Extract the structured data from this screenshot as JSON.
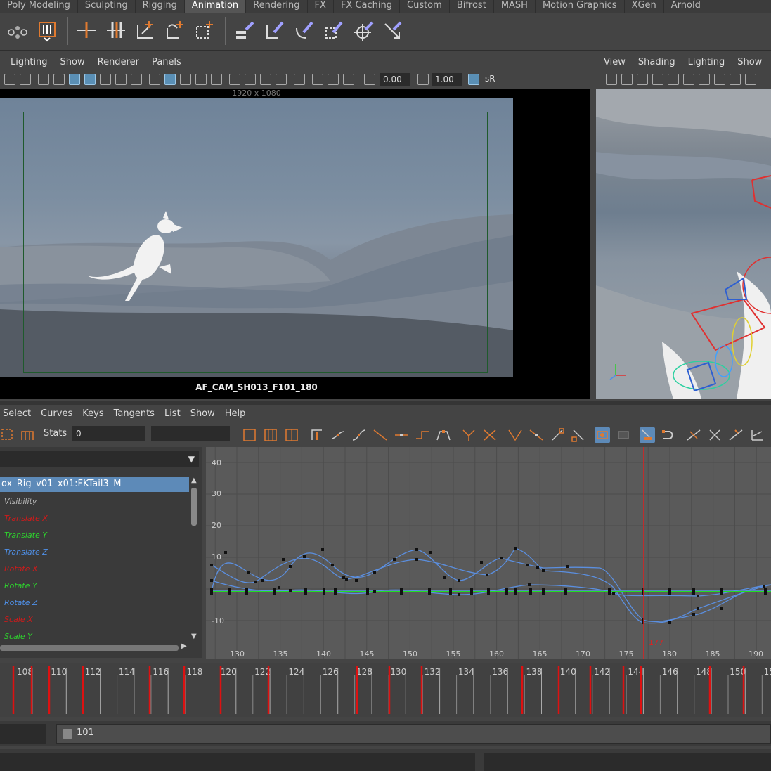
{
  "shelf": {
    "tabs": [
      {
        "label": "Poly Modeling",
        "active": false
      },
      {
        "label": "Sculpting",
        "active": false
      },
      {
        "label": "Rigging",
        "active": false
      },
      {
        "label": "Animation",
        "active": true
      },
      {
        "label": "Rendering",
        "active": false
      },
      {
        "label": "FX",
        "active": false
      },
      {
        "label": "FX Caching",
        "active": false
      },
      {
        "label": "Custom",
        "active": false
      },
      {
        "label": "Bifrost",
        "active": false
      },
      {
        "label": "MASH",
        "active": false
      },
      {
        "label": "Motion Graphics",
        "active": false
      },
      {
        "label": "XGen",
        "active": false
      },
      {
        "label": "Arnold",
        "active": false
      }
    ],
    "icons": [
      "ghost-icon",
      "bake-icon",
      "translate-key-icon",
      "set-key-icon",
      "joint-icon",
      "ik-handle-icon",
      "bind-skin-icon",
      "rig-constraint-icon",
      "parent-constraint-icon",
      "point-constraint-icon",
      "orient-constraint-icon",
      "scale-constraint-icon",
      "aim-constraint-icon",
      "pole-vector-icon"
    ]
  },
  "left_panel": {
    "menu": [
      "Lighting",
      "Show",
      "Renderer",
      "Panels"
    ],
    "exposure_value": "0.00",
    "gamma_value": "1.00",
    "color_space_label": "sR",
    "resolution_label": "1920 x 1080",
    "camera_label": "AF_CAM_SH013_F101_180"
  },
  "right_panel": {
    "menu": [
      "View",
      "Shading",
      "Lighting",
      "Show"
    ]
  },
  "graph_editor": {
    "menu": [
      "Select",
      "Curves",
      "Keys",
      "Tangents",
      "List",
      "Show",
      "Help"
    ],
    "stats_label": "Stats",
    "stats_value": "0",
    "selected_node": "ox_Rig_v01_x01:FKTail3_M",
    "attributes": [
      {
        "label": "Visibility",
        "color": "#bbbbbb"
      },
      {
        "label": "Translate X",
        "color": "#d11a1a"
      },
      {
        "label": "Translate Y",
        "color": "#2ed12e"
      },
      {
        "label": "Translate Z",
        "color": "#4f8fe6"
      },
      {
        "label": "Rotate X",
        "color": "#d11a1a"
      },
      {
        "label": "Rotate Y",
        "color": "#2ed12e"
      },
      {
        "label": "Rotate Z",
        "color": "#4f8fe6"
      },
      {
        "label": "Scale X",
        "color": "#d11a1a"
      },
      {
        "label": "Scale Y",
        "color": "#2ed12e"
      }
    ],
    "y_ticks": [
      "40",
      "30",
      "20",
      "10",
      "-10"
    ],
    "x_ticks": [
      "130",
      "135",
      "140",
      "145",
      "150",
      "155",
      "160",
      "165",
      "170",
      "175",
      "180",
      "185",
      "190"
    ],
    "current_frame": "177",
    "colors": {
      "current_time": "#e02020",
      "curve_blue": "#5b8fe0",
      "curve_green": "#22dd22"
    }
  },
  "time_slider": {
    "labels": [
      "108",
      "110",
      "112",
      "114",
      "116",
      "118",
      "120",
      "122",
      "124",
      "126",
      "128",
      "130",
      "132",
      "134",
      "136",
      "138",
      "140",
      "142",
      "144",
      "146",
      "148",
      "150",
      "15"
    ]
  },
  "range_slider": {
    "start_value": "101"
  }
}
